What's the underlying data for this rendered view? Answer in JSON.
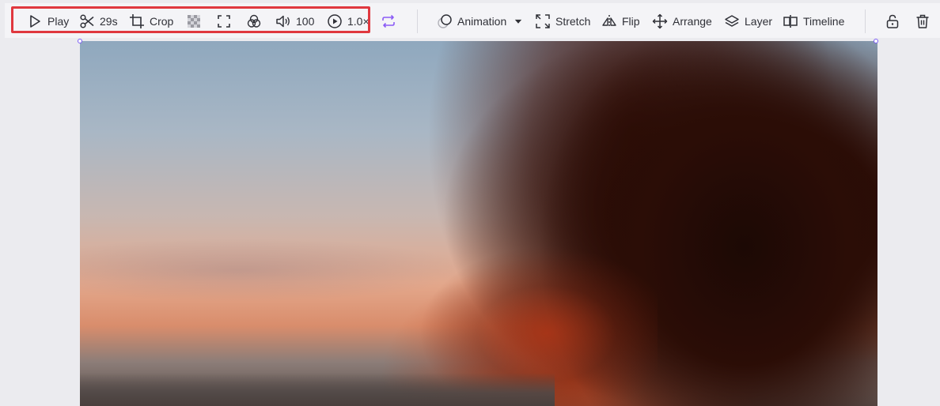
{
  "toolbar": {
    "play_label": "Play",
    "duration_label": "29s",
    "crop_label": "Crop",
    "volume_value": "100",
    "speed_value": "1.0×",
    "animation_label": "Animation",
    "stretch_label": "Stretch",
    "flip_label": "Flip",
    "arrange_label": "Arrange",
    "layer_label": "Layer",
    "timeline_label": "Timeline"
  },
  "colors": {
    "highlight_border": "#e0383f",
    "accent_purple": "#8b5cf6",
    "toolbar_bg": "#f4f4f7"
  },
  "icons": [
    "play-icon",
    "scissors-icon",
    "crop-icon",
    "transparency-icon",
    "fit-frame-icon",
    "adjust-icon",
    "volume-icon",
    "speed-icon",
    "loop-icon",
    "animation-icon",
    "stretch-icon",
    "flip-icon",
    "arrange-icon",
    "layer-icon",
    "timeline-icon",
    "unlock-icon",
    "trash-icon"
  ]
}
